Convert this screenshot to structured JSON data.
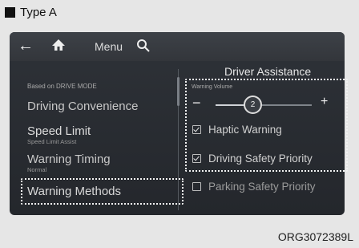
{
  "header": {
    "type_label": "Type A"
  },
  "topbar": {
    "back_icon": "arrow-left-icon",
    "home_icon": "home-icon",
    "menu_label": "Menu",
    "search_icon": "search-icon"
  },
  "left_menu": {
    "mode_caption": "Based on DRIVE MODE",
    "items": [
      {
        "label": "Driving Convenience",
        "sub": ""
      },
      {
        "label": "Speed Limit",
        "sub": "Speed Limit Assist"
      },
      {
        "label": "Warning Timing",
        "sub": "Normal"
      },
      {
        "label": "Warning Methods",
        "sub": "",
        "selected": true
      }
    ]
  },
  "right_panel": {
    "title": "Driver Assistance",
    "volume": {
      "label": "Warning Volume",
      "value": "2",
      "minus": "−",
      "plus": "+",
      "level_fraction": 0.4
    },
    "options": [
      {
        "label": "Haptic Warning",
        "checked": true
      },
      {
        "label": "Driving Safety Priority",
        "checked": true
      },
      {
        "label": "Parking Safety Priority",
        "checked": false
      }
    ]
  },
  "footer": {
    "code": "ORG3072389L"
  },
  "colors": {
    "screen_bg": "#2e3238",
    "text_active": "#e6e6e6",
    "text_dim": "#a8a8a8",
    "page_bg": "#e6e6e6"
  }
}
